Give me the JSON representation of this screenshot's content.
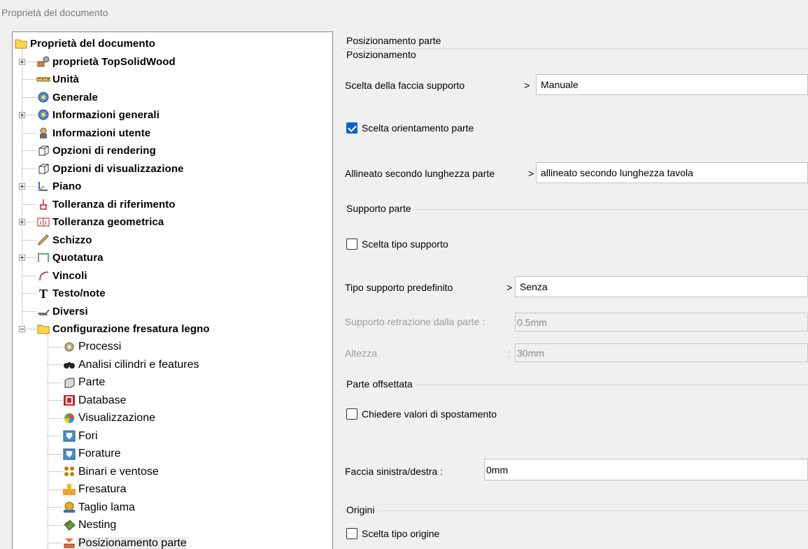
{
  "window": {
    "title": "Proprietà del documento"
  },
  "tree": {
    "nodes": [
      {
        "label": "Proprietà del documento",
        "icon": "folder-icon",
        "bold": true
      },
      {
        "label": "proprietà TopSolidWood",
        "icon": "wood-properties-icon",
        "bold": true,
        "expander": "plus"
      },
      {
        "label": "Unità",
        "icon": "ruler-icon",
        "bold": true
      },
      {
        "label": "Generale",
        "icon": "general-info-icon",
        "bold": true
      },
      {
        "label": "Informazioni generali",
        "icon": "general-info-icon",
        "bold": true,
        "expander": "plus"
      },
      {
        "label": "Informazioni utente",
        "icon": "user-icon",
        "bold": true
      },
      {
        "label": "Opzioni di rendering",
        "icon": "cube-icon",
        "bold": true
      },
      {
        "label": "Opzioni di visualizzazione",
        "icon": "cube-icon",
        "bold": true
      },
      {
        "label": "Piano",
        "icon": "plane-axes-icon",
        "bold": true,
        "expander": "plus"
      },
      {
        "label": "Tolleranza di riferimento",
        "icon": "datum-tolerance-icon",
        "bold": true
      },
      {
        "label": "Tolleranza geometrica",
        "icon": "geometric-tolerance-icon",
        "bold": true,
        "expander": "plus"
      },
      {
        "label": "Schizzo",
        "icon": "pencil-icon",
        "bold": true
      },
      {
        "label": "Quotatura",
        "icon": "dimension-icon",
        "bold": true,
        "expander": "plus"
      },
      {
        "label": "Vincoli",
        "icon": "constraint-icon",
        "bold": true
      },
      {
        "label": "Testo/note",
        "icon": "text-icon",
        "bold": true
      },
      {
        "label": "Diversi",
        "icon": "misc-icon",
        "bold": true
      },
      {
        "label": "Configurazione fresatura legno",
        "icon": "folder-icon",
        "bold": true,
        "expander": "minus"
      },
      {
        "label": "Processi",
        "icon": "process-gears-icon",
        "bold": false
      },
      {
        "label": "Analisi cilindri e features",
        "icon": "binoculars-icon",
        "bold": false
      },
      {
        "label": "Parte",
        "icon": "part-cube-icon",
        "bold": false
      },
      {
        "label": "Database",
        "icon": "database-icon",
        "bold": false
      },
      {
        "label": "Visualizzazione",
        "icon": "color-wheel-icon",
        "bold": false
      },
      {
        "label": "Fori",
        "icon": "hole-icon",
        "bold": false
      },
      {
        "label": "Forature",
        "icon": "drilling-icon",
        "bold": false
      },
      {
        "label": "Binari e ventose",
        "icon": "suction-cups-icon",
        "bold": false
      },
      {
        "label": "Fresatura",
        "icon": "milling-icon",
        "bold": false
      },
      {
        "label": "Taglio lama",
        "icon": "saw-blade-icon",
        "bold": false
      },
      {
        "label": "Nesting",
        "icon": "nesting-icon",
        "bold": false
      },
      {
        "label": "Posizionamento parte",
        "icon": "part-positioning-icon",
        "bold": false,
        "selected": true
      }
    ]
  },
  "panel": {
    "header": "Posizionamento parte",
    "positioning": {
      "title": "Posizionamento",
      "face_label": "Scelta della faccia supporto",
      "face_value": "Manuale",
      "orient_check": "Scelta orientamento parte",
      "orient_checked": true,
      "align_label": "Allineato secondo lunghezza parte",
      "align_value": "allineato secondo lunghezza tavola"
    },
    "support": {
      "title": "Supporto parte",
      "type_check": "Scelta tipo supporto",
      "type_checked": false,
      "default_label": "Tipo supporto predefinito",
      "default_value": "Senza",
      "retraction_label": "Supporto retrazione dalla parte :",
      "retraction_value": "0.5mm",
      "height_label": "Altezza",
      "height_colon": ":",
      "height_value": "30mm"
    },
    "offset": {
      "title": "Parte offsettata",
      "ask_check": "Chiedere valori di spostamento",
      "ask_checked": false,
      "lr_label": "Faccia sinistra/destra :",
      "lr_value": "0mm"
    },
    "origins": {
      "title": "Origini",
      "type_check": "Scelta tipo origine",
      "type_checked": false
    },
    "arrow": ">"
  },
  "colors": {
    "check_accent": "#0a64d0",
    "panel_bg": "#f0f0f0",
    "tree_border": "#828790"
  }
}
